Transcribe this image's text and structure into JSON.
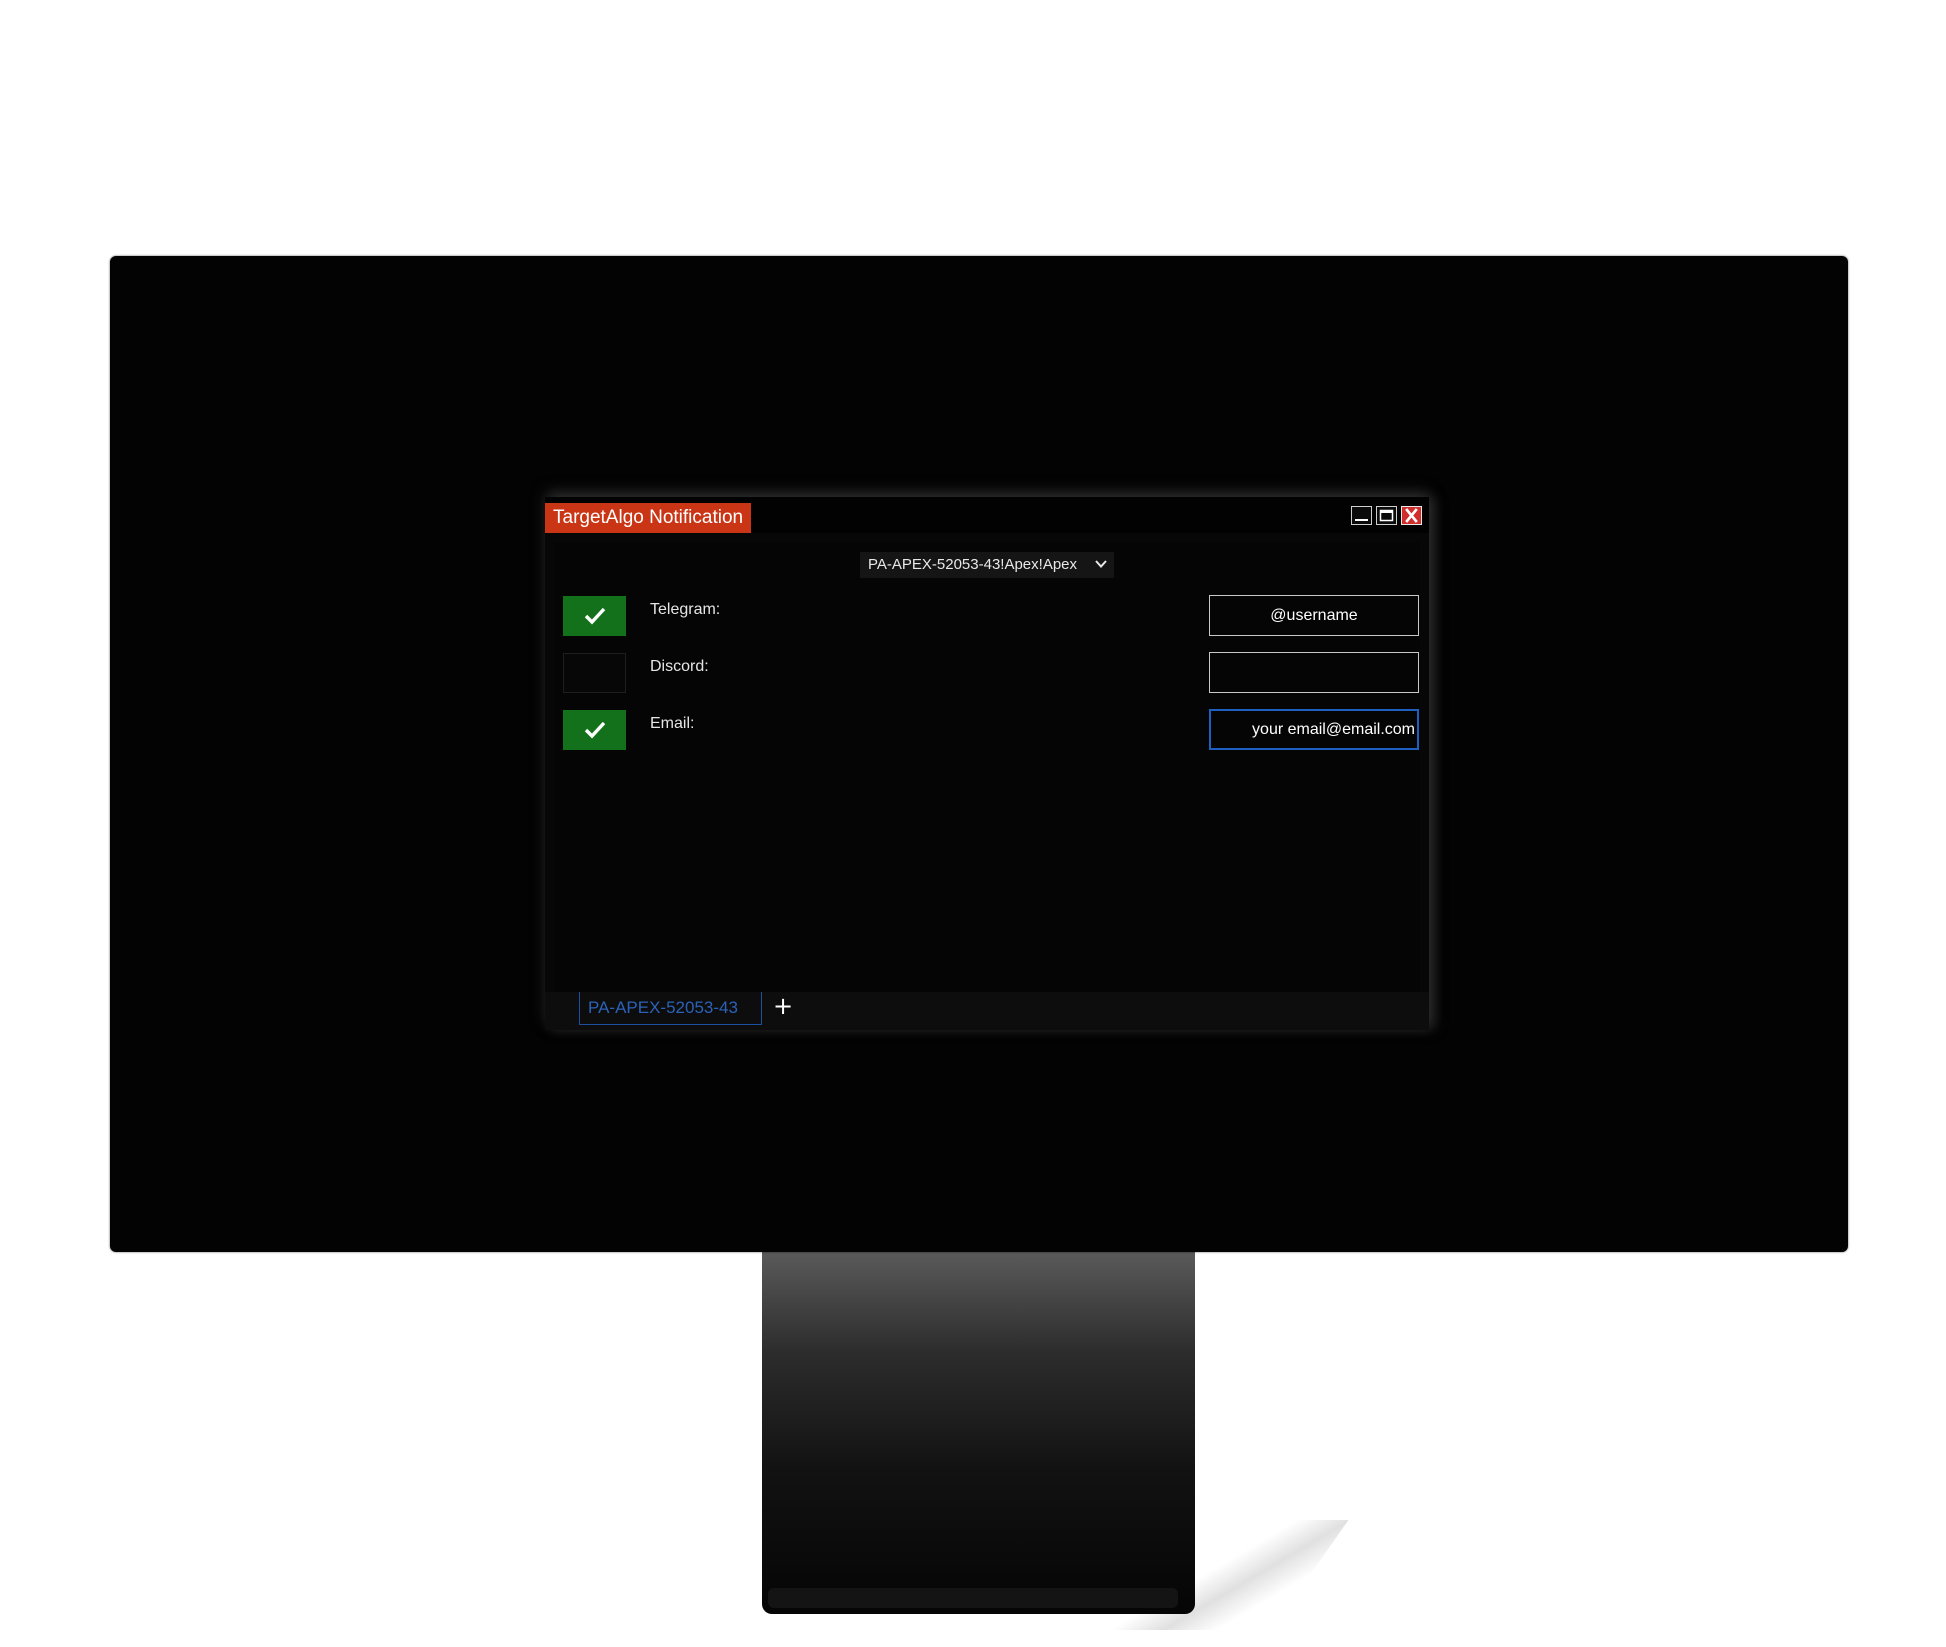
{
  "window": {
    "title": "TargetAlgo Notification",
    "controls": [
      "minimize",
      "maximize",
      "close"
    ]
  },
  "account_select": {
    "value": "PA-APEX-52053-43!Apex!Apex"
  },
  "notifications": [
    {
      "label": "Telegram:",
      "enabled": true,
      "value": "@username",
      "placeholder": ""
    },
    {
      "label": "Discord:",
      "enabled": false,
      "value": "",
      "placeholder": ""
    },
    {
      "label": "Email:",
      "enabled": true,
      "value": "your email@email.com",
      "placeholder": ""
    }
  ],
  "tabs": {
    "active": "PA-APEX-52053-43",
    "add_label": "+"
  },
  "colors": {
    "title_accent": "#c93515",
    "check_on": "#13711b",
    "tab_accent": "#2b62b8",
    "focus_border": "#1f5fbf"
  },
  "icons": {
    "check": "checkmark-icon",
    "dropdown": "chevron-down-icon",
    "minimize": "minimize-icon",
    "maximize": "maximize-icon",
    "close": "close-icon"
  }
}
